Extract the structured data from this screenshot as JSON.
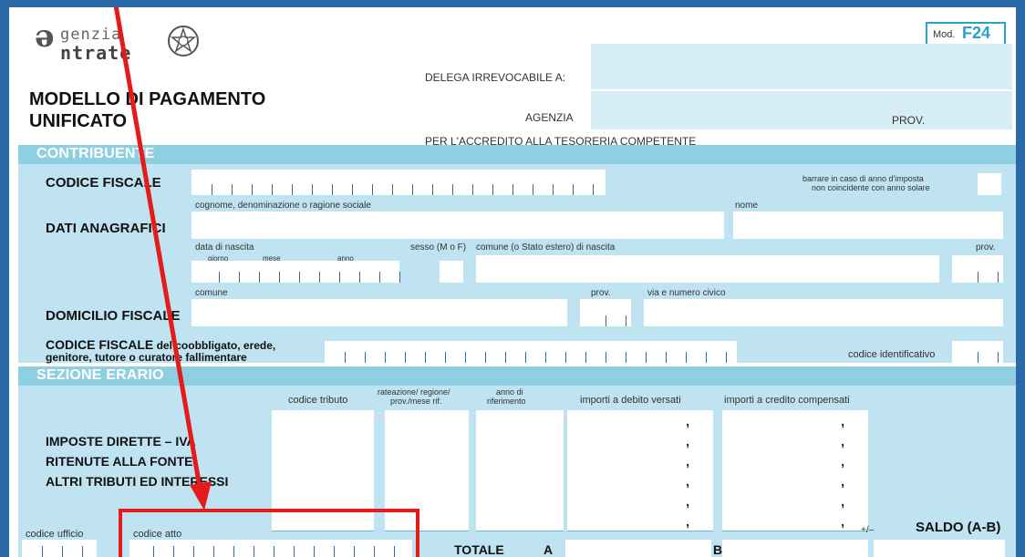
{
  "header": {
    "logo_line1": "genzia",
    "logo_line2": "ntrate",
    "title_line1": "MODELLO DI PAGAMENTO",
    "title_line2": "UNIFICATO",
    "mod_label": "Mod.",
    "mod_code": "F24",
    "delega_label": "DELEGA IRREVOCABILE A:",
    "agenzia_label": "AGENZIA",
    "prov_label": "PROV.",
    "accredito_label": "PER L'ACCREDITO ALLA TESORERIA COMPETENTE"
  },
  "contribuente": {
    "section_title": "CONTRIBUENTE",
    "codice_fiscale": "CODICE FISCALE",
    "anno_imposta_line1": "barrare in caso di anno d'imposta",
    "anno_imposta_line2": "non coincidente con anno solare",
    "cognome_label": "cognome, denominazione o ragione sociale",
    "nome_label": "nome",
    "dati_anagrafici": "DATI ANAGRAFICI",
    "data_nascita_label": "data di nascita",
    "giorno_label": "giorno",
    "mese_label": "mese",
    "anno_label": "anno",
    "sesso_label": "sesso (M o F)",
    "comune_nascita_label": "comune (o Stato estero) di nascita",
    "prov_label": "prov.",
    "comune_label": "comune",
    "prov2_label": "prov.",
    "via_label": "via e numero civico",
    "domicilio_fiscale": "DOMICILIO FISCALE",
    "cf_coobbligato_bold": "CODICE FISCALE",
    "cf_coobbligato_rest": " del coobbligato, erede,",
    "cf_coobbligato_line2": "genitore, tutore o curatore fallimentare",
    "codice_identificativo_label": "codice identificativo"
  },
  "erario": {
    "section_title": "SEZIONE ERARIO",
    "col_codice_tributo": "codice tributo",
    "col_rateazione_line1": "rateazione/ regione/",
    "col_rateazione_line2": "prov./mese rif.",
    "col_anno_line1": "anno di",
    "col_anno_line2": "riferimento",
    "col_debito": "importi a debito versati",
    "col_credito": "importi a credito compensati",
    "row_label_1": "IMPOSTE DIRETTE – IVA",
    "row_label_2": "RITENUTE ALLA FONTE",
    "row_label_3": "ALTRI TRIBUTI ED INTERESSI",
    "codice_ufficio_label": "codice ufficio",
    "codice_atto_label": "codice atto",
    "totale_label": "TOTALE",
    "totale_a": "A",
    "totale_b": "B",
    "plus_minus": "+/–",
    "saldo_label": "SALDO (A-B)",
    "comma": ","
  },
  "colors": {
    "field": "#d6edf6",
    "section_bar": "#8ecfe2",
    "frame": "#2a6aa8",
    "annotation": "#e51a1a"
  }
}
